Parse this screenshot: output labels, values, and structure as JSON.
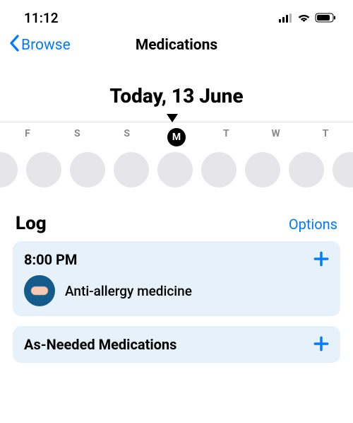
{
  "status": {
    "time": "11:12"
  },
  "nav": {
    "back_label": "Browse",
    "title": "Medications"
  },
  "date": "Today, 13 June",
  "days": [
    "F",
    "S",
    "S",
    "M",
    "T",
    "W",
    "T"
  ],
  "active_day_index": 3,
  "log": {
    "title": "Log",
    "options_label": "Options"
  },
  "schedule": {
    "time": "8:00 PM",
    "medication": "Anti-allergy medicine",
    "icon": "pill-icon"
  },
  "as_needed": {
    "title": "As-Needed Medications"
  },
  "colors": {
    "accent": "#007aff",
    "card_bg": "#e6f1fa",
    "pill_bg": "#125b8a"
  }
}
